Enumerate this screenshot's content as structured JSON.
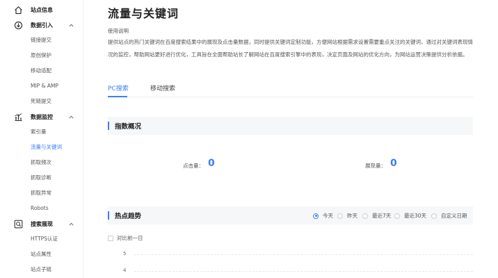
{
  "sidebar": {
    "groups": [
      {
        "label": "站点信息",
        "icon": "home-icon",
        "has_chevron": false,
        "items": []
      },
      {
        "label": "数据引入",
        "icon": "data-import-icon",
        "has_chevron": true,
        "items": [
          {
            "label": "链接提交"
          },
          {
            "label": "原创保护"
          },
          {
            "label": "移动适配"
          },
          {
            "label": "MIP & AMP"
          },
          {
            "label": "死链提交"
          }
        ]
      },
      {
        "label": "数据监控",
        "icon": "bar-chart-icon",
        "has_chevron": true,
        "items": [
          {
            "label": "索引量"
          },
          {
            "label": "流量与关键词",
            "active": true
          },
          {
            "label": "抓取频次"
          },
          {
            "label": "抓取诊断"
          },
          {
            "label": "抓取异常"
          },
          {
            "label": "Robots"
          }
        ]
      },
      {
        "label": "搜索展现",
        "icon": "search-display-icon",
        "has_chevron": true,
        "items": [
          {
            "label": "HTTPS认证"
          },
          {
            "label": "站点属性"
          },
          {
            "label": "站点子链"
          }
        ]
      }
    ]
  },
  "main": {
    "title": "流量与关键词",
    "description_title": "使用说明",
    "description": "提供站点的热门关键词在百度搜索结果中的展现及点击量数据，同时提供关键词定制功能，方便网站根据需求设置需要重点关注的关键词，通过对关键词表现情况的监控，帮助网站更好进行优化，工具旨在全面帮助站长了解网站在百度搜索引擎中的表现，决定页面及网站的优化方向，为网站运营决策提供分析依据。",
    "tabs": [
      {
        "label": "PC搜索",
        "active": true
      },
      {
        "label": "移动搜索",
        "active": false
      }
    ],
    "overview": {
      "title": "指数概况",
      "clicks_label": "点击量：",
      "clicks_value": "0",
      "impressions_label": "展现量：",
      "impressions_value": "0"
    },
    "trend": {
      "title": "热点趋势",
      "ranges": [
        {
          "label": "今天",
          "checked": true
        },
        {
          "label": "昨天",
          "checked": false
        },
        {
          "label": "最近7天",
          "checked": false
        },
        {
          "label": "最近30天",
          "checked": false
        },
        {
          "label": "自定义日期",
          "checked": false
        }
      ],
      "compare_label": "对比前一日"
    }
  },
  "chart_data": {
    "type": "line",
    "y_ticks": [
      "5",
      "4"
    ],
    "series": []
  },
  "colors": {
    "accent": "#3a7ff6",
    "panel_bg": "#f6f7f9",
    "divider": "#eef0f3"
  }
}
